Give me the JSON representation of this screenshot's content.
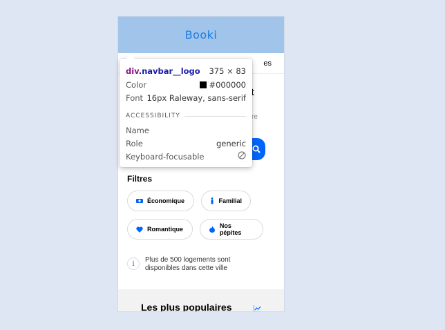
{
  "page": {
    "logo": "Booki",
    "nav_partial": "es",
    "hero_title_partial": "t",
    "hero_sub_partial": "re"
  },
  "filters": {
    "title": "Filtres",
    "chips": [
      {
        "label": "Économique",
        "icon": "money-icon"
      },
      {
        "label": "Familial",
        "icon": "person-icon"
      },
      {
        "label": "Romantique",
        "icon": "heart-icon"
      },
      {
        "label": "Nos pépites",
        "icon": "fire-icon"
      }
    ]
  },
  "info": {
    "icon": "i",
    "text": "Plus de 500 logements sont disponibles dans cette ville"
  },
  "popular": {
    "title": "Les plus populaires",
    "icon": "chart-line-icon"
  },
  "tooltip": {
    "tag": "div",
    "class_name": ".navbar__logo",
    "size": "375 × 83",
    "color_label": "Color",
    "color_value": "#000000",
    "font_label": "Font",
    "font_value": "16px Raleway, sans-serif",
    "section": "ACCESSIBILITY",
    "name_label": "Name",
    "name_value": "",
    "role_label": "Role",
    "role_value": "generic",
    "focus_label": "Keyboard-focusable"
  },
  "colors": {
    "accent": "#0065fc",
    "navbar_bg": "#a0c4ea",
    "page_bg": "#dfe6f3"
  }
}
